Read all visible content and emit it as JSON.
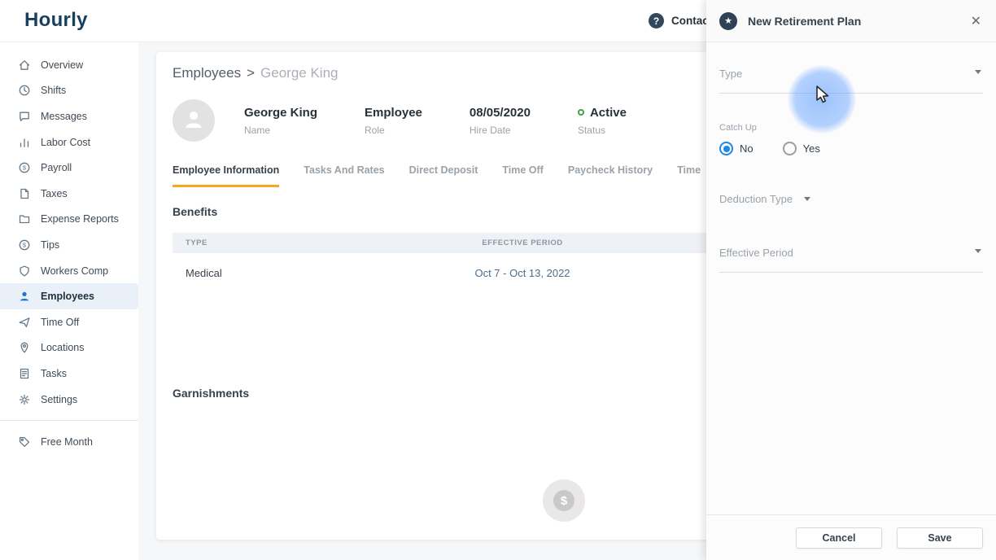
{
  "icons": {
    "help": "?",
    "star": "★",
    "close": "✕",
    "dollar": "$"
  },
  "header": {
    "logo": "Hourly",
    "contact": "Contact"
  },
  "sidebar": {
    "active_index": 9,
    "items": [
      {
        "label": "Overview",
        "icon": "home-icon"
      },
      {
        "label": "Shifts",
        "icon": "clock-icon"
      },
      {
        "label": "Messages",
        "icon": "chat-icon"
      },
      {
        "label": "Labor Cost",
        "icon": "bar-chart-icon"
      },
      {
        "label": "Payroll",
        "icon": "dollar-circle-icon"
      },
      {
        "label": "Taxes",
        "icon": "document-icon"
      },
      {
        "label": "Expense Reports",
        "icon": "folder-icon"
      },
      {
        "label": "Tips",
        "icon": "dollar-circle-icon"
      },
      {
        "label": "Workers Comp",
        "icon": "shield-icon"
      },
      {
        "label": "Employees",
        "icon": "person-icon"
      },
      {
        "label": "Time Off",
        "icon": "paper-plane-icon"
      },
      {
        "label": "Locations",
        "icon": "location-pin-icon"
      },
      {
        "label": "Tasks",
        "icon": "task-list-icon"
      },
      {
        "label": "Settings",
        "icon": "gear-icon"
      },
      {
        "label": "Free Month",
        "icon": "tag-icon"
      }
    ]
  },
  "main": {
    "breadcrumb": {
      "parent": "Employees",
      "separator": ">",
      "current": "George King"
    },
    "employee": {
      "name": "George King",
      "name_label": "Name",
      "role": "Employee",
      "role_label": "Role",
      "hire_date": "08/05/2020",
      "hire_date_label": "Hire Date",
      "status": "Active",
      "status_label": "Status"
    },
    "tabs": [
      "Employee Information",
      "Tasks And Rates",
      "Direct Deposit",
      "Time Off",
      "Paycheck History",
      "Time"
    ],
    "active_tab": 0,
    "benefits": {
      "title": "Benefits",
      "table": {
        "headers": [
          "TYPE",
          "EFFECTIVE PERIOD"
        ],
        "rows": [
          [
            "Medical",
            "Oct 7 - Oct 13, 2022"
          ]
        ]
      }
    },
    "garnishments_title": "Garnishments"
  },
  "drawer": {
    "title": "New Retirement Plan",
    "type_label": "Type",
    "catch_up": {
      "label": "Catch Up",
      "options": [
        "No",
        "Yes"
      ],
      "selected": "No"
    },
    "deduction_type_label": "Deduction Type",
    "effective_period_label": "Effective Period",
    "cancel_label": "Cancel",
    "save_label": "Save"
  },
  "colors": {
    "brand": "#173f5f",
    "accent_orange": "#f5a623",
    "radio_blue": "#1e88e5",
    "status_green": "#43a047",
    "active_sidebar_blue": "#1976d2"
  }
}
